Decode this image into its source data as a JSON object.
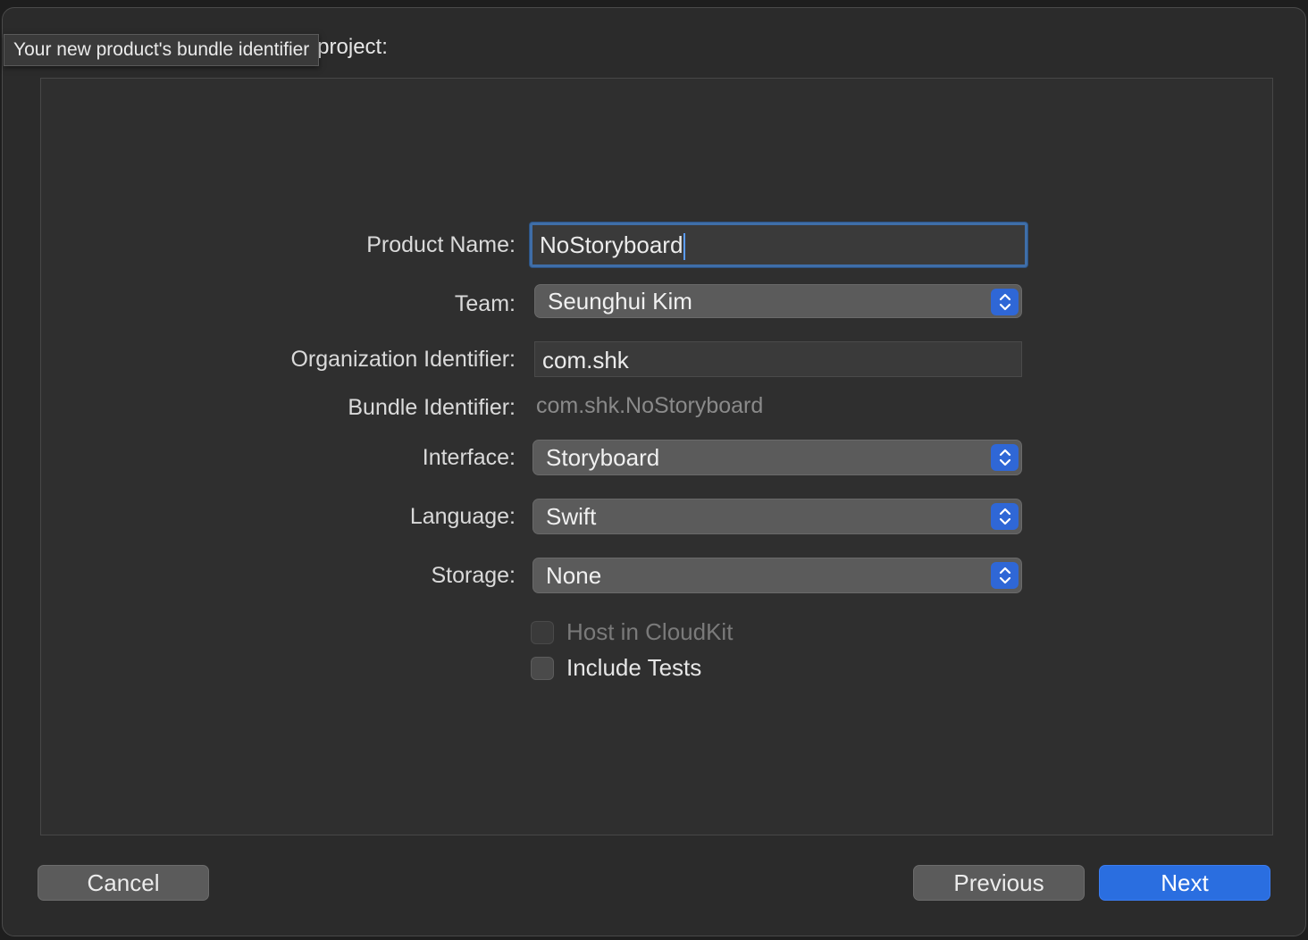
{
  "dialog": {
    "heading": "Choose options for your new project:",
    "tooltip": "Your new product's bundle identifier"
  },
  "form": {
    "product_name": {
      "label": "Product Name:",
      "value": "NoStoryboard"
    },
    "team": {
      "label": "Team:",
      "value": "Seunghui Kim"
    },
    "organization_identifier": {
      "label": "Organization Identifier:",
      "value": "com.shk"
    },
    "bundle_identifier": {
      "label": "Bundle Identifier:",
      "value": "com.shk.NoStoryboard"
    },
    "interface": {
      "label": "Interface:",
      "value": "Storyboard"
    },
    "language": {
      "label": "Language:",
      "value": "Swift"
    },
    "storage": {
      "label": "Storage:",
      "value": "None"
    },
    "host_in_cloudkit": {
      "label": "Host in CloudKit",
      "checked": false,
      "enabled": false
    },
    "include_tests": {
      "label": "Include Tests",
      "checked": false,
      "enabled": true
    }
  },
  "buttons": {
    "cancel": "Cancel",
    "previous": "Previous",
    "next": "Next"
  },
  "colors": {
    "accent": "#2a6ee0",
    "background": "#2b2b2b"
  },
  "icons": {
    "popup_stepper": "up-down-chevron-icon"
  }
}
